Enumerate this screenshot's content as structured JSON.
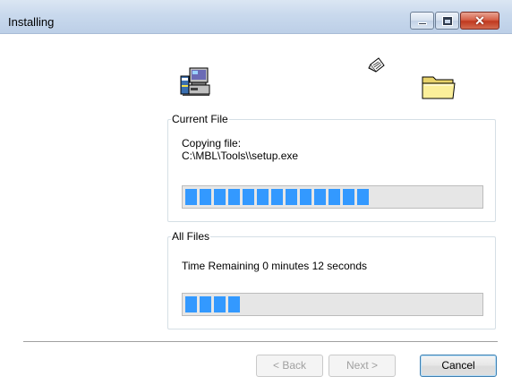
{
  "window": {
    "title": "Installing",
    "close_glyph": "✕"
  },
  "icons": {
    "computer": "computer-setup-icon",
    "paper": "flying-paper-icon",
    "folder": "folder-icon"
  },
  "current_file": {
    "legend": "Current File",
    "copy_label": "Copying file:",
    "path": "C:\\MBL\\Tools\\\\setup.exe",
    "progress_fraction": 0.64
  },
  "all_files": {
    "legend": "All Files",
    "time_remaining": "Time Remaining 0 minutes 12 seconds",
    "progress_fraction": 0.21
  },
  "buttons": {
    "back": "< Back",
    "next": "Next >",
    "cancel": "Cancel"
  },
  "colors": {
    "progress": "#3399ff"
  }
}
